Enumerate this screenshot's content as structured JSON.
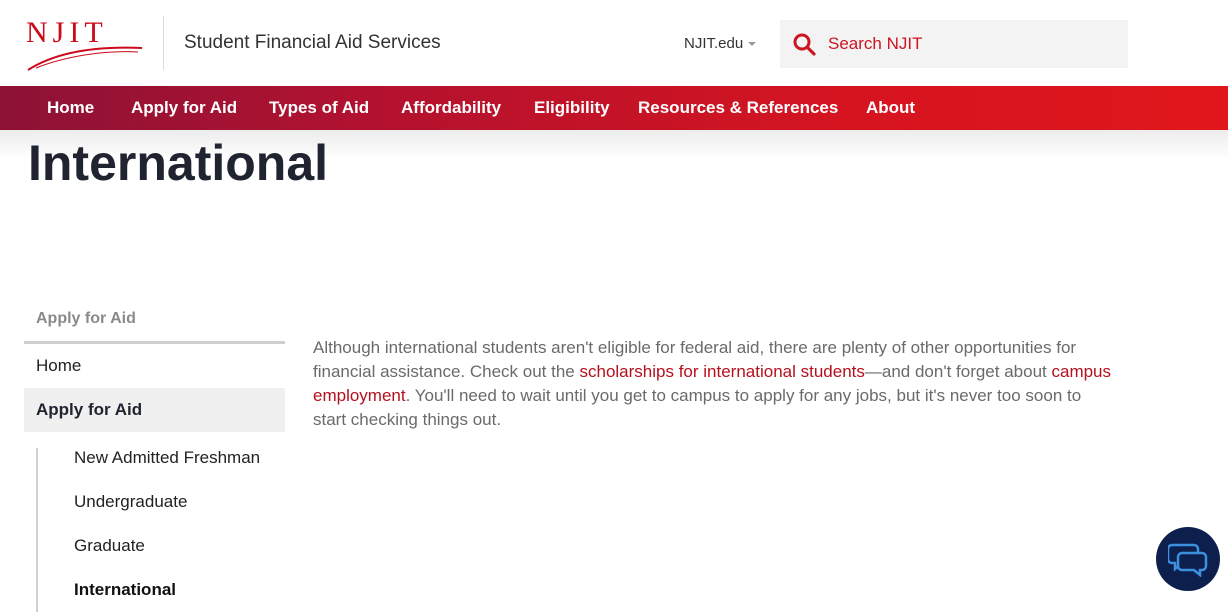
{
  "header": {
    "logo_text": "NJIT",
    "site_title": "Student Financial Aid Services",
    "domain_menu": "NJIT.edu",
    "search_placeholder": "Search NJIT"
  },
  "nav": {
    "items": [
      {
        "label": "Home"
      },
      {
        "label": "Apply for Aid"
      },
      {
        "label": "Types of Aid"
      },
      {
        "label": "Affordability"
      },
      {
        "label": "Eligibility"
      },
      {
        "label": "Resources & References"
      },
      {
        "label": "About"
      }
    ]
  },
  "page": {
    "title": "International"
  },
  "sidebar": {
    "heading": "Apply for Aid",
    "home": "Home",
    "active": "Apply for Aid",
    "subitems": [
      {
        "label": "New Admitted Freshman"
      },
      {
        "label": "Undergraduate"
      },
      {
        "label": "Graduate"
      },
      {
        "label": "International"
      }
    ]
  },
  "content": {
    "p1": "Although international students aren't eligible for federal aid, there are plenty of other opportunities for financial assistance. Check out the ",
    "link1": "scholarships for international students",
    "p2": "—and don't forget about ",
    "link2": "campus employment",
    "p3": ". You'll need to wait until you get to campus to apply for any jobs, but it's never too soon to start checking things out."
  },
  "colors": {
    "brand_red": "#cc0a1b",
    "nav_gradient_start": "#8c1236",
    "nav_gradient_end": "#e0161c",
    "chat_bg": "#0d1f4d"
  },
  "icons": {
    "search": "search-icon",
    "caret": "chevron-down-icon",
    "chat": "chat-bubbles-icon"
  }
}
